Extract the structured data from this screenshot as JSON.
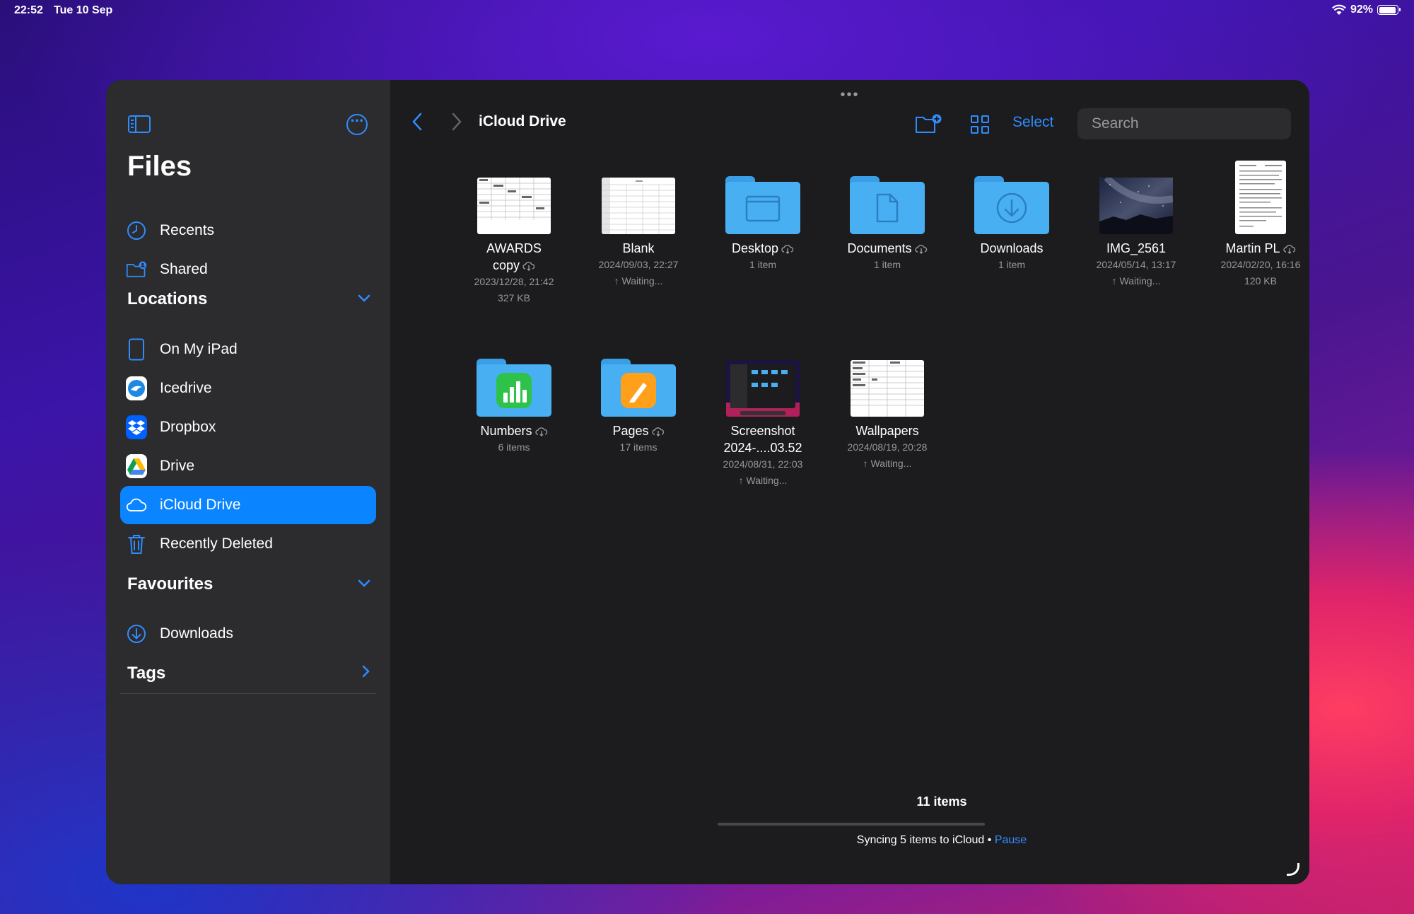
{
  "status": {
    "time": "22:52",
    "date": "Tue 10 Sep",
    "battery": "92%",
    "battery_level": 0.92
  },
  "sidebar": {
    "title": "Files",
    "top_items": [
      {
        "label": "Recents",
        "icon": "clock-icon"
      },
      {
        "label": "Shared",
        "icon": "shared-folder-icon"
      }
    ],
    "locations_header": "Locations",
    "locations": [
      {
        "label": "On My iPad",
        "icon": "ipad-icon"
      },
      {
        "label": "Icedrive",
        "icon": "icedrive-icon"
      },
      {
        "label": "Dropbox",
        "icon": "dropbox-icon"
      },
      {
        "label": "Drive",
        "icon": "google-drive-icon"
      },
      {
        "label": "iCloud Drive",
        "icon": "icloud-icon",
        "selected": true
      },
      {
        "label": "Recently Deleted",
        "icon": "trash-icon"
      }
    ],
    "favourites_header": "Favourites",
    "favourites": [
      {
        "label": "Downloads",
        "icon": "download-circle-icon"
      }
    ],
    "tags_header": "Tags"
  },
  "toolbar": {
    "title": "iCloud Drive",
    "select_label": "Select",
    "search_placeholder": "Search"
  },
  "files": [
    {
      "name": "AWARDS copy",
      "line1": "AWARDS",
      "line2": "copy",
      "meta": [
        "2023/12/28, 21:42",
        "327 KB"
      ],
      "cloud": true,
      "kind": "sheet"
    },
    {
      "name": "Blank",
      "meta": [
        "2024/09/03, 22:27",
        "↑ Waiting..."
      ],
      "cloud": false,
      "kind": "sheet-blank"
    },
    {
      "name": "Desktop",
      "meta": [
        "1 item"
      ],
      "cloud": true,
      "kind": "folder-desktop"
    },
    {
      "name": "Documents",
      "meta": [
        "1 item"
      ],
      "cloud": true,
      "kind": "folder-docs"
    },
    {
      "name": "Downloads",
      "meta": [
        "1 item"
      ],
      "cloud": false,
      "kind": "folder-downloads"
    },
    {
      "name": "IMG_2561",
      "meta": [
        "2024/05/14, 13:17",
        "↑ Waiting..."
      ],
      "cloud": false,
      "kind": "photo"
    },
    {
      "name": "Martin PL",
      "meta": [
        "2024/02/20, 16:16",
        "120 KB"
      ],
      "cloud": true,
      "kind": "pdf"
    },
    {
      "name": "Numbers",
      "meta": [
        "6 items"
      ],
      "cloud": true,
      "kind": "folder-numbers"
    },
    {
      "name": "Pages",
      "meta": [
        "17 items"
      ],
      "cloud": true,
      "kind": "folder-pages"
    },
    {
      "name": "Screenshot 2024-....03.52",
      "line1": "Screenshot",
      "line2": "2024-....03.52",
      "meta": [
        "2024/08/31, 22:03",
        "↑ Waiting..."
      ],
      "cloud": false,
      "kind": "screenshot"
    },
    {
      "name": "Wallpapers",
      "meta": [
        "2024/08/19, 20:28",
        "↑ Waiting..."
      ],
      "cloud": false,
      "kind": "sheet"
    }
  ],
  "footer": {
    "count": "11 items",
    "sync_text": "Syncing 5 items to iCloud",
    "separator": "•",
    "pause_label": "Pause",
    "progress": 0.0
  },
  "colors": {
    "accent": "#0a84ff",
    "folder": "#48b0f2",
    "sidebar_bg": "#2c2c2e",
    "main_bg": "#1c1c1e"
  }
}
